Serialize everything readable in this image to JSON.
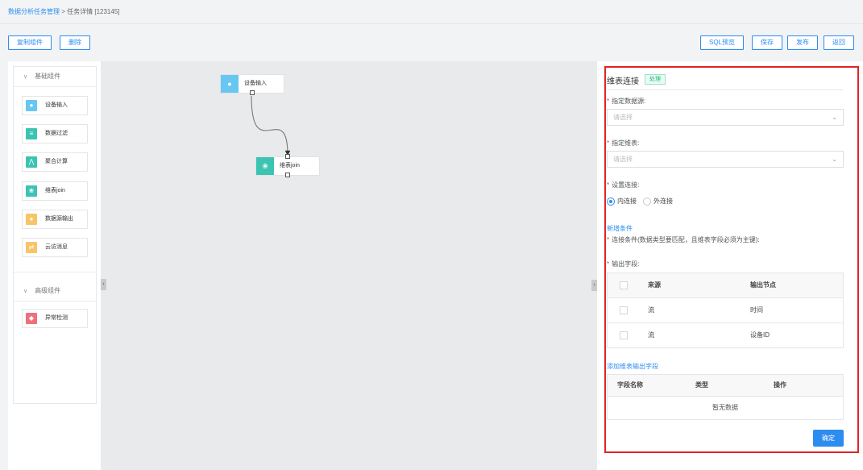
{
  "breadcrumb": {
    "link": "数据分析任务管理",
    "separator": " > ",
    "current": "任务详情 [123145]"
  },
  "toolbar": {
    "copy_label": "复制组件",
    "delete_label": "删除",
    "sql_preview_label": "SQL预览",
    "save_label": "保存",
    "publish_label": "发布",
    "back_label": "返回"
  },
  "sidebar": {
    "basic_group": "基础组件",
    "basic_items": [
      {
        "label": "设备输入",
        "icon": "device-input-icon",
        "color": "#68c6f2"
      },
      {
        "label": "数据过滤",
        "icon": "data-filter-icon",
        "color": "#3bc4b1"
      },
      {
        "label": "聚合计算",
        "icon": "aggregate-icon",
        "color": "#3bc4b1"
      },
      {
        "label": "维表join",
        "icon": "dimension-join-icon",
        "color": "#3bc4b1"
      },
      {
        "label": "数据源输出",
        "icon": "datasource-output-icon",
        "color": "#f7c567"
      },
      {
        "label": "云访消息",
        "icon": "cloud-message-icon",
        "color": "#f7c567"
      }
    ],
    "advanced_group": "高级组件",
    "advanced_items": [
      {
        "label": "异常检测",
        "icon": "anomaly-detect-icon",
        "color": "#ef6f7c"
      }
    ]
  },
  "canvas": {
    "nodes": [
      {
        "label": "设备输入",
        "icon": "device-input-icon",
        "color": "#68c6f2"
      },
      {
        "label": "维表join",
        "icon": "dimension-join-icon",
        "color": "#3bc4b1"
      }
    ]
  },
  "config": {
    "title": "维表连接",
    "tag": "处理",
    "datasource_label": "指定数据源:",
    "datasource_placeholder": "请选择",
    "dimtable_label": "指定维表:",
    "dimtable_placeholder": "请选择",
    "join_label": "设置连接:",
    "join_inner": "内连接",
    "join_outer": "外连接",
    "join_selected": "内连接",
    "add_condition": "新增条件",
    "condition_note": "连接条件(数据类型要匹配，且维表字段必须为主键):",
    "output_label": "输出字段:",
    "output_table": {
      "headers": [
        "来源",
        "输出节点"
      ],
      "rows": [
        [
          "流",
          "时间"
        ],
        [
          "流",
          "设备ID"
        ]
      ]
    },
    "add_output": "添加维表输出字段",
    "field_table": {
      "headers": [
        "字段名称",
        "类型",
        "操作"
      ],
      "empty": "暂无数据"
    },
    "confirm_label": "确定"
  }
}
